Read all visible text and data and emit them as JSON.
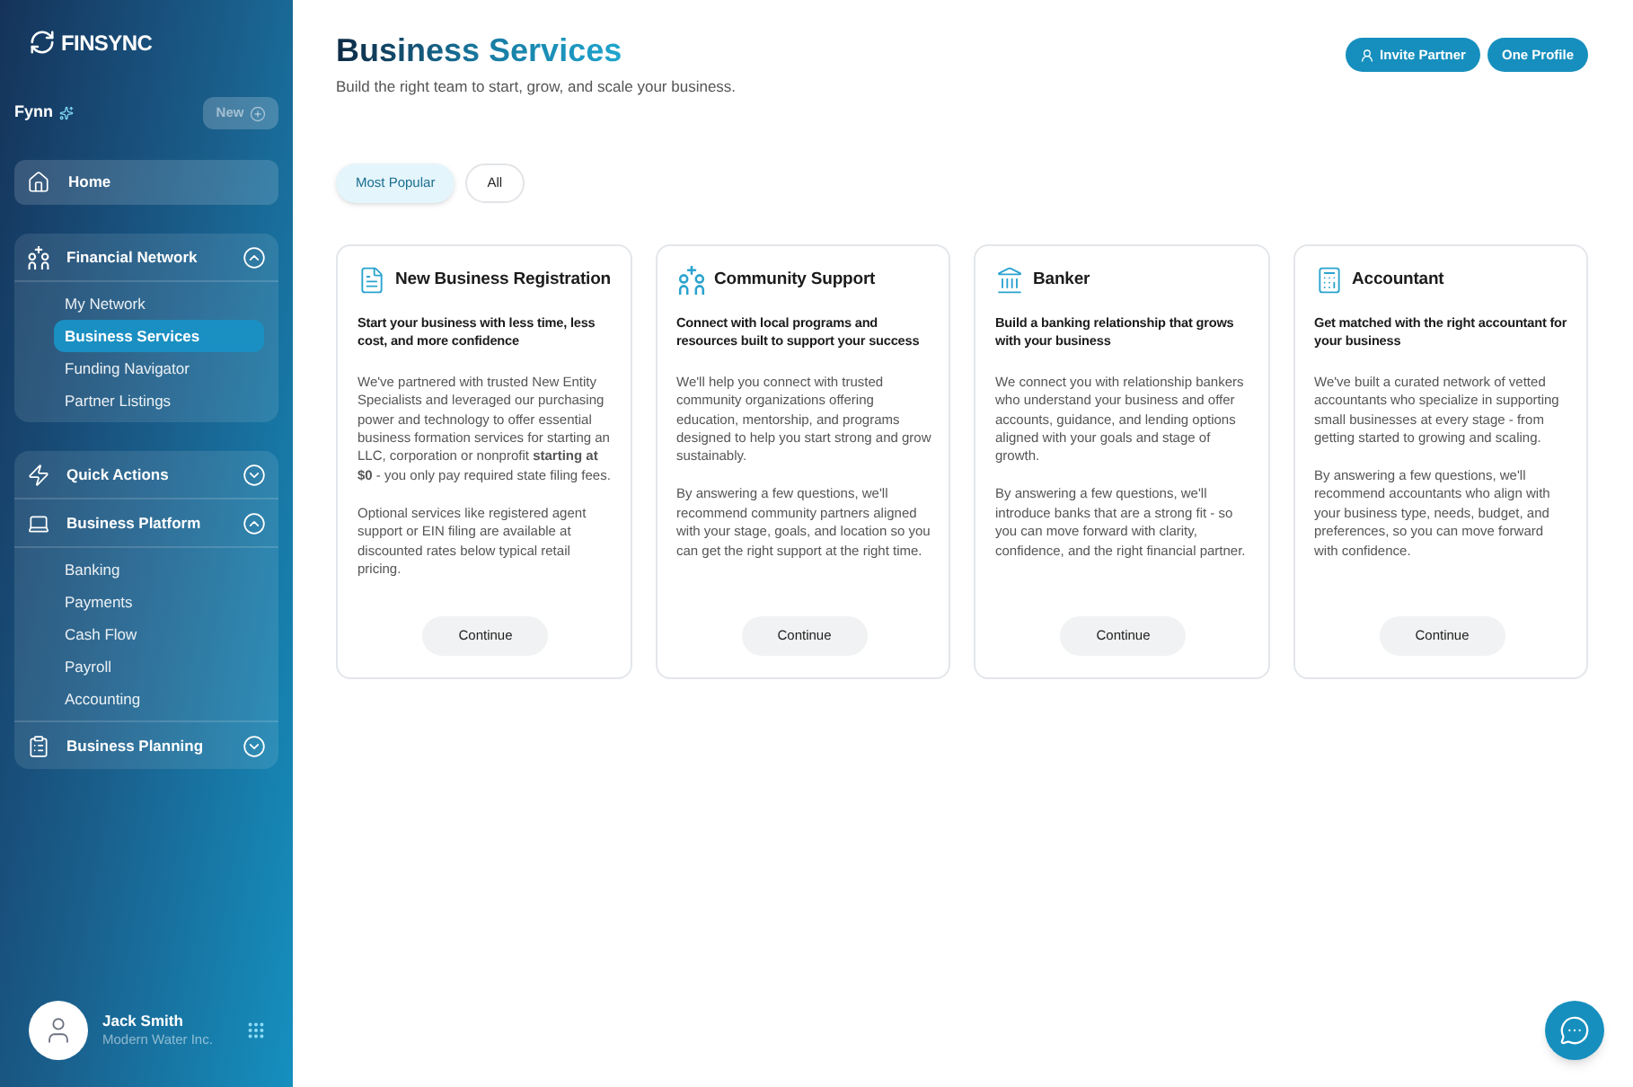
{
  "sidebar": {
    "logo": {
      "text": "FINSYNC"
    },
    "assistant": {
      "name": "Fynn",
      "new_button": "New"
    },
    "nav": [
      {
        "kind": "link",
        "label": "Home"
      },
      {
        "kind": "panel",
        "sections": [
          {
            "label": "Financial Network",
            "expanded": true,
            "children": [
              {
                "label": "My Network",
                "selected": false
              },
              {
                "label": "Business Services",
                "selected": true
              },
              {
                "label": "Funding Navigator",
                "selected": false
              },
              {
                "label": "Partner Listings",
                "selected": false
              }
            ]
          }
        ]
      },
      {
        "kind": "panel",
        "sections": [
          {
            "label": "Quick Actions",
            "expanded": false
          },
          {
            "label": "Business Platform",
            "expanded": true,
            "children": [
              {
                "label": "Banking",
                "selected": false
              },
              {
                "label": "Payments",
                "selected": false
              },
              {
                "label": "Cash Flow",
                "selected": false
              },
              {
                "label": "Payroll",
                "selected": false
              },
              {
                "label": "Accounting",
                "selected": false
              }
            ]
          },
          {
            "label": "Business Planning",
            "expanded": false
          }
        ]
      }
    ],
    "user": {
      "name": "Jack Smith",
      "company": "Modern Water Inc."
    }
  },
  "header": {
    "title": "Business Services",
    "subtitle": "Build the right team to start, grow, and scale your business.",
    "actions": [
      {
        "label": "Invite Partner"
      },
      {
        "label": "One Profile"
      }
    ]
  },
  "filters": [
    {
      "label": "Most Popular",
      "selected": true
    },
    {
      "label": "All",
      "selected": false
    }
  ],
  "cards": [
    {
      "title": "New Business Registration",
      "subtitle": "Start your business with less time, less cost, and more confidence",
      "paragraphs": [
        "We've partnered with trusted New Entity Specialists and leveraged our purchasing power and technology to offer essential business formation services for starting an LLC, corporation or nonprofit **starting at $0** - you only pay required state filing fees.",
        "Optional services like registered agent support or EIN filing are available at discounted rates below typical retail pricing."
      ],
      "button": "Continue"
    },
    {
      "title": "Community Support",
      "subtitle": "Connect with local programs and resources built to support your success",
      "paragraphs": [
        "We'll help you connect with trusted community organizations offering education, mentorship, and programs designed to help you start strong and grow sustainably.",
        "By answering a few questions, we'll recommend community partners aligned with your stage, goals, and location so you can get the right support at the right time."
      ],
      "button": "Continue"
    },
    {
      "title": "Banker",
      "subtitle": "Build a banking relationship that grows with your business",
      "paragraphs": [
        "We connect you with relationship bankers who understand your business and offer accounts, guidance, and lending options aligned with your goals and stage of growth.",
        "By answering a few questions, we'll introduce banks that are a strong fit - so you can move forward with clarity, confidence, and the right financial partner."
      ],
      "button": "Continue"
    },
    {
      "title": "Accountant",
      "subtitle": "Get matched with the right accountant for your business",
      "paragraphs": [
        "We've built a curated network of vetted accountants who specialize in supporting small businesses at every stage - from getting started to growing and scaling.",
        "By answering a few questions, we'll recommend accountants who align with your business type, needs, budget, and preferences, so you can move forward with confidence."
      ],
      "button": "Continue"
    }
  ]
}
